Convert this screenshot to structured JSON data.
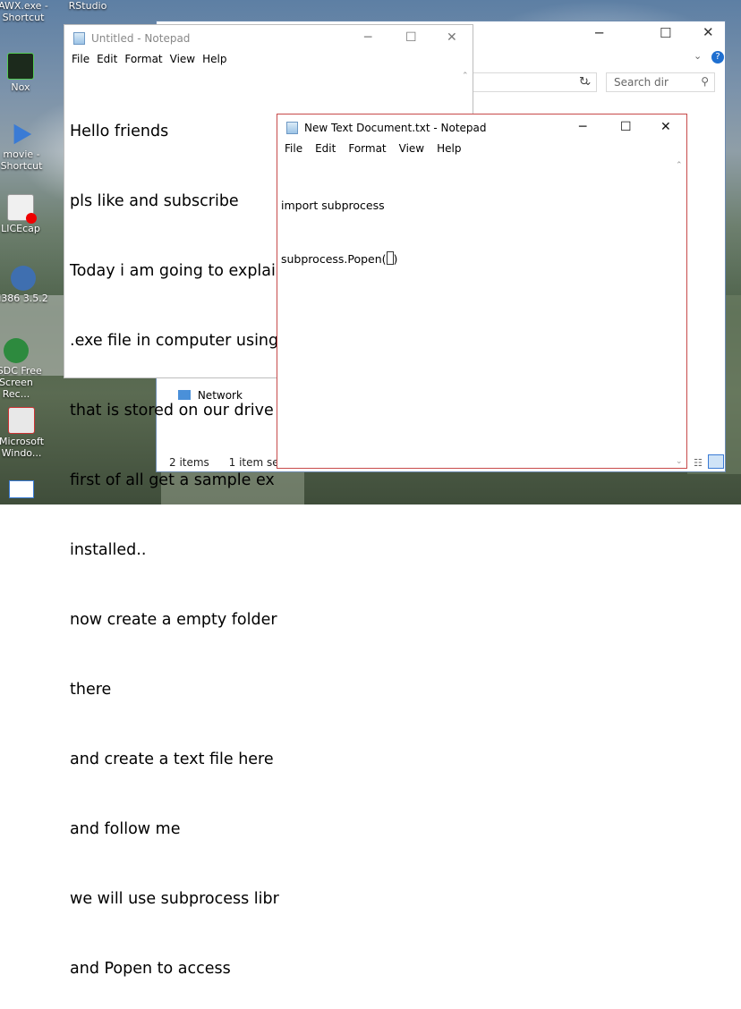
{
  "desktop": {
    "icons": [
      {
        "label": "AWX.exe - Shortcut",
        "color": "#1a1a1a"
      },
      {
        "label": "RStudio",
        "color": "#4a7ab5"
      },
      {
        "label": "Nox",
        "color": "#1c2a1c"
      },
      {
        "label": "movie - Shortcut",
        "color": "#3a7bd5"
      },
      {
        "label": "LICEcap",
        "color": "#f0f0f0"
      },
      {
        "label": "i386 3.5.2",
        "color": "#3f6fb0"
      },
      {
        "label": "VSDC Free Screen Rec...",
        "color": "#2d8a3e"
      },
      {
        "label": "Microsoft Windo...",
        "color": "#e8e8e8"
      }
    ]
  },
  "explorer": {
    "search_placeholder": "Search dir",
    "nav_network": "Network",
    "status_items": "2 items",
    "status_selected": "1 item selec"
  },
  "notepad1": {
    "title": "Untitled - Notepad",
    "menu": [
      "File",
      "Edit",
      "Format",
      "View",
      "Help"
    ],
    "lines": [
      "Hello friends",
      "pls like and subscribe",
      "Today i am going to explain",
      ".exe file in computer using",
      "that is stored on our drive",
      "first of all get a sample ex",
      "installed..",
      "now create a empty folder",
      "there",
      "and create a text file here",
      "and follow me",
      "we will use subprocess libr",
      "and Popen to access"
    ]
  },
  "notepad2": {
    "title": "New Text Document.txt - Notepad",
    "menu": [
      "File",
      "Edit",
      "Format",
      "View",
      "Help"
    ],
    "line1": "import subprocess",
    "line2_prefix": "subprocess.Popen(",
    "line2_suffix": ")"
  }
}
